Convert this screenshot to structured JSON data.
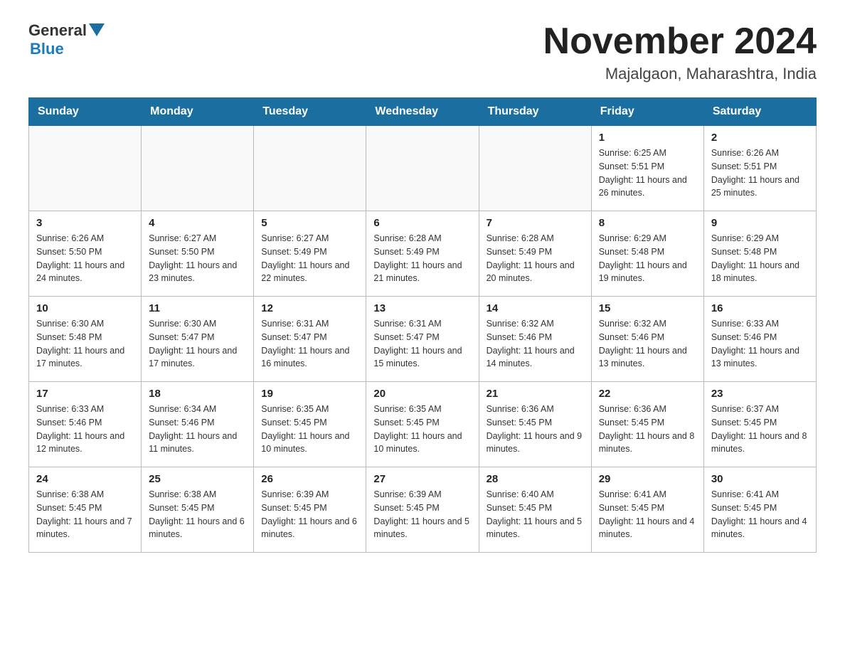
{
  "logo": {
    "text_general": "General",
    "text_blue": "Blue"
  },
  "title": "November 2024",
  "subtitle": "Majalgaon, Maharashtra, India",
  "days_of_week": [
    "Sunday",
    "Monday",
    "Tuesday",
    "Wednesday",
    "Thursday",
    "Friday",
    "Saturday"
  ],
  "weeks": [
    [
      {
        "day": "",
        "info": ""
      },
      {
        "day": "",
        "info": ""
      },
      {
        "day": "",
        "info": ""
      },
      {
        "day": "",
        "info": ""
      },
      {
        "day": "",
        "info": ""
      },
      {
        "day": "1",
        "info": "Sunrise: 6:25 AM\nSunset: 5:51 PM\nDaylight: 11 hours and 26 minutes."
      },
      {
        "day": "2",
        "info": "Sunrise: 6:26 AM\nSunset: 5:51 PM\nDaylight: 11 hours and 25 minutes."
      }
    ],
    [
      {
        "day": "3",
        "info": "Sunrise: 6:26 AM\nSunset: 5:50 PM\nDaylight: 11 hours and 24 minutes."
      },
      {
        "day": "4",
        "info": "Sunrise: 6:27 AM\nSunset: 5:50 PM\nDaylight: 11 hours and 23 minutes."
      },
      {
        "day": "5",
        "info": "Sunrise: 6:27 AM\nSunset: 5:49 PM\nDaylight: 11 hours and 22 minutes."
      },
      {
        "day": "6",
        "info": "Sunrise: 6:28 AM\nSunset: 5:49 PM\nDaylight: 11 hours and 21 minutes."
      },
      {
        "day": "7",
        "info": "Sunrise: 6:28 AM\nSunset: 5:49 PM\nDaylight: 11 hours and 20 minutes."
      },
      {
        "day": "8",
        "info": "Sunrise: 6:29 AM\nSunset: 5:48 PM\nDaylight: 11 hours and 19 minutes."
      },
      {
        "day": "9",
        "info": "Sunrise: 6:29 AM\nSunset: 5:48 PM\nDaylight: 11 hours and 18 minutes."
      }
    ],
    [
      {
        "day": "10",
        "info": "Sunrise: 6:30 AM\nSunset: 5:48 PM\nDaylight: 11 hours and 17 minutes."
      },
      {
        "day": "11",
        "info": "Sunrise: 6:30 AM\nSunset: 5:47 PM\nDaylight: 11 hours and 17 minutes."
      },
      {
        "day": "12",
        "info": "Sunrise: 6:31 AM\nSunset: 5:47 PM\nDaylight: 11 hours and 16 minutes."
      },
      {
        "day": "13",
        "info": "Sunrise: 6:31 AM\nSunset: 5:47 PM\nDaylight: 11 hours and 15 minutes."
      },
      {
        "day": "14",
        "info": "Sunrise: 6:32 AM\nSunset: 5:46 PM\nDaylight: 11 hours and 14 minutes."
      },
      {
        "day": "15",
        "info": "Sunrise: 6:32 AM\nSunset: 5:46 PM\nDaylight: 11 hours and 13 minutes."
      },
      {
        "day": "16",
        "info": "Sunrise: 6:33 AM\nSunset: 5:46 PM\nDaylight: 11 hours and 13 minutes."
      }
    ],
    [
      {
        "day": "17",
        "info": "Sunrise: 6:33 AM\nSunset: 5:46 PM\nDaylight: 11 hours and 12 minutes."
      },
      {
        "day": "18",
        "info": "Sunrise: 6:34 AM\nSunset: 5:46 PM\nDaylight: 11 hours and 11 minutes."
      },
      {
        "day": "19",
        "info": "Sunrise: 6:35 AM\nSunset: 5:45 PM\nDaylight: 11 hours and 10 minutes."
      },
      {
        "day": "20",
        "info": "Sunrise: 6:35 AM\nSunset: 5:45 PM\nDaylight: 11 hours and 10 minutes."
      },
      {
        "day": "21",
        "info": "Sunrise: 6:36 AM\nSunset: 5:45 PM\nDaylight: 11 hours and 9 minutes."
      },
      {
        "day": "22",
        "info": "Sunrise: 6:36 AM\nSunset: 5:45 PM\nDaylight: 11 hours and 8 minutes."
      },
      {
        "day": "23",
        "info": "Sunrise: 6:37 AM\nSunset: 5:45 PM\nDaylight: 11 hours and 8 minutes."
      }
    ],
    [
      {
        "day": "24",
        "info": "Sunrise: 6:38 AM\nSunset: 5:45 PM\nDaylight: 11 hours and 7 minutes."
      },
      {
        "day": "25",
        "info": "Sunrise: 6:38 AM\nSunset: 5:45 PM\nDaylight: 11 hours and 6 minutes."
      },
      {
        "day": "26",
        "info": "Sunrise: 6:39 AM\nSunset: 5:45 PM\nDaylight: 11 hours and 6 minutes."
      },
      {
        "day": "27",
        "info": "Sunrise: 6:39 AM\nSunset: 5:45 PM\nDaylight: 11 hours and 5 minutes."
      },
      {
        "day": "28",
        "info": "Sunrise: 6:40 AM\nSunset: 5:45 PM\nDaylight: 11 hours and 5 minutes."
      },
      {
        "day": "29",
        "info": "Sunrise: 6:41 AM\nSunset: 5:45 PM\nDaylight: 11 hours and 4 minutes."
      },
      {
        "day": "30",
        "info": "Sunrise: 6:41 AM\nSunset: 5:45 PM\nDaylight: 11 hours and 4 minutes."
      }
    ]
  ]
}
